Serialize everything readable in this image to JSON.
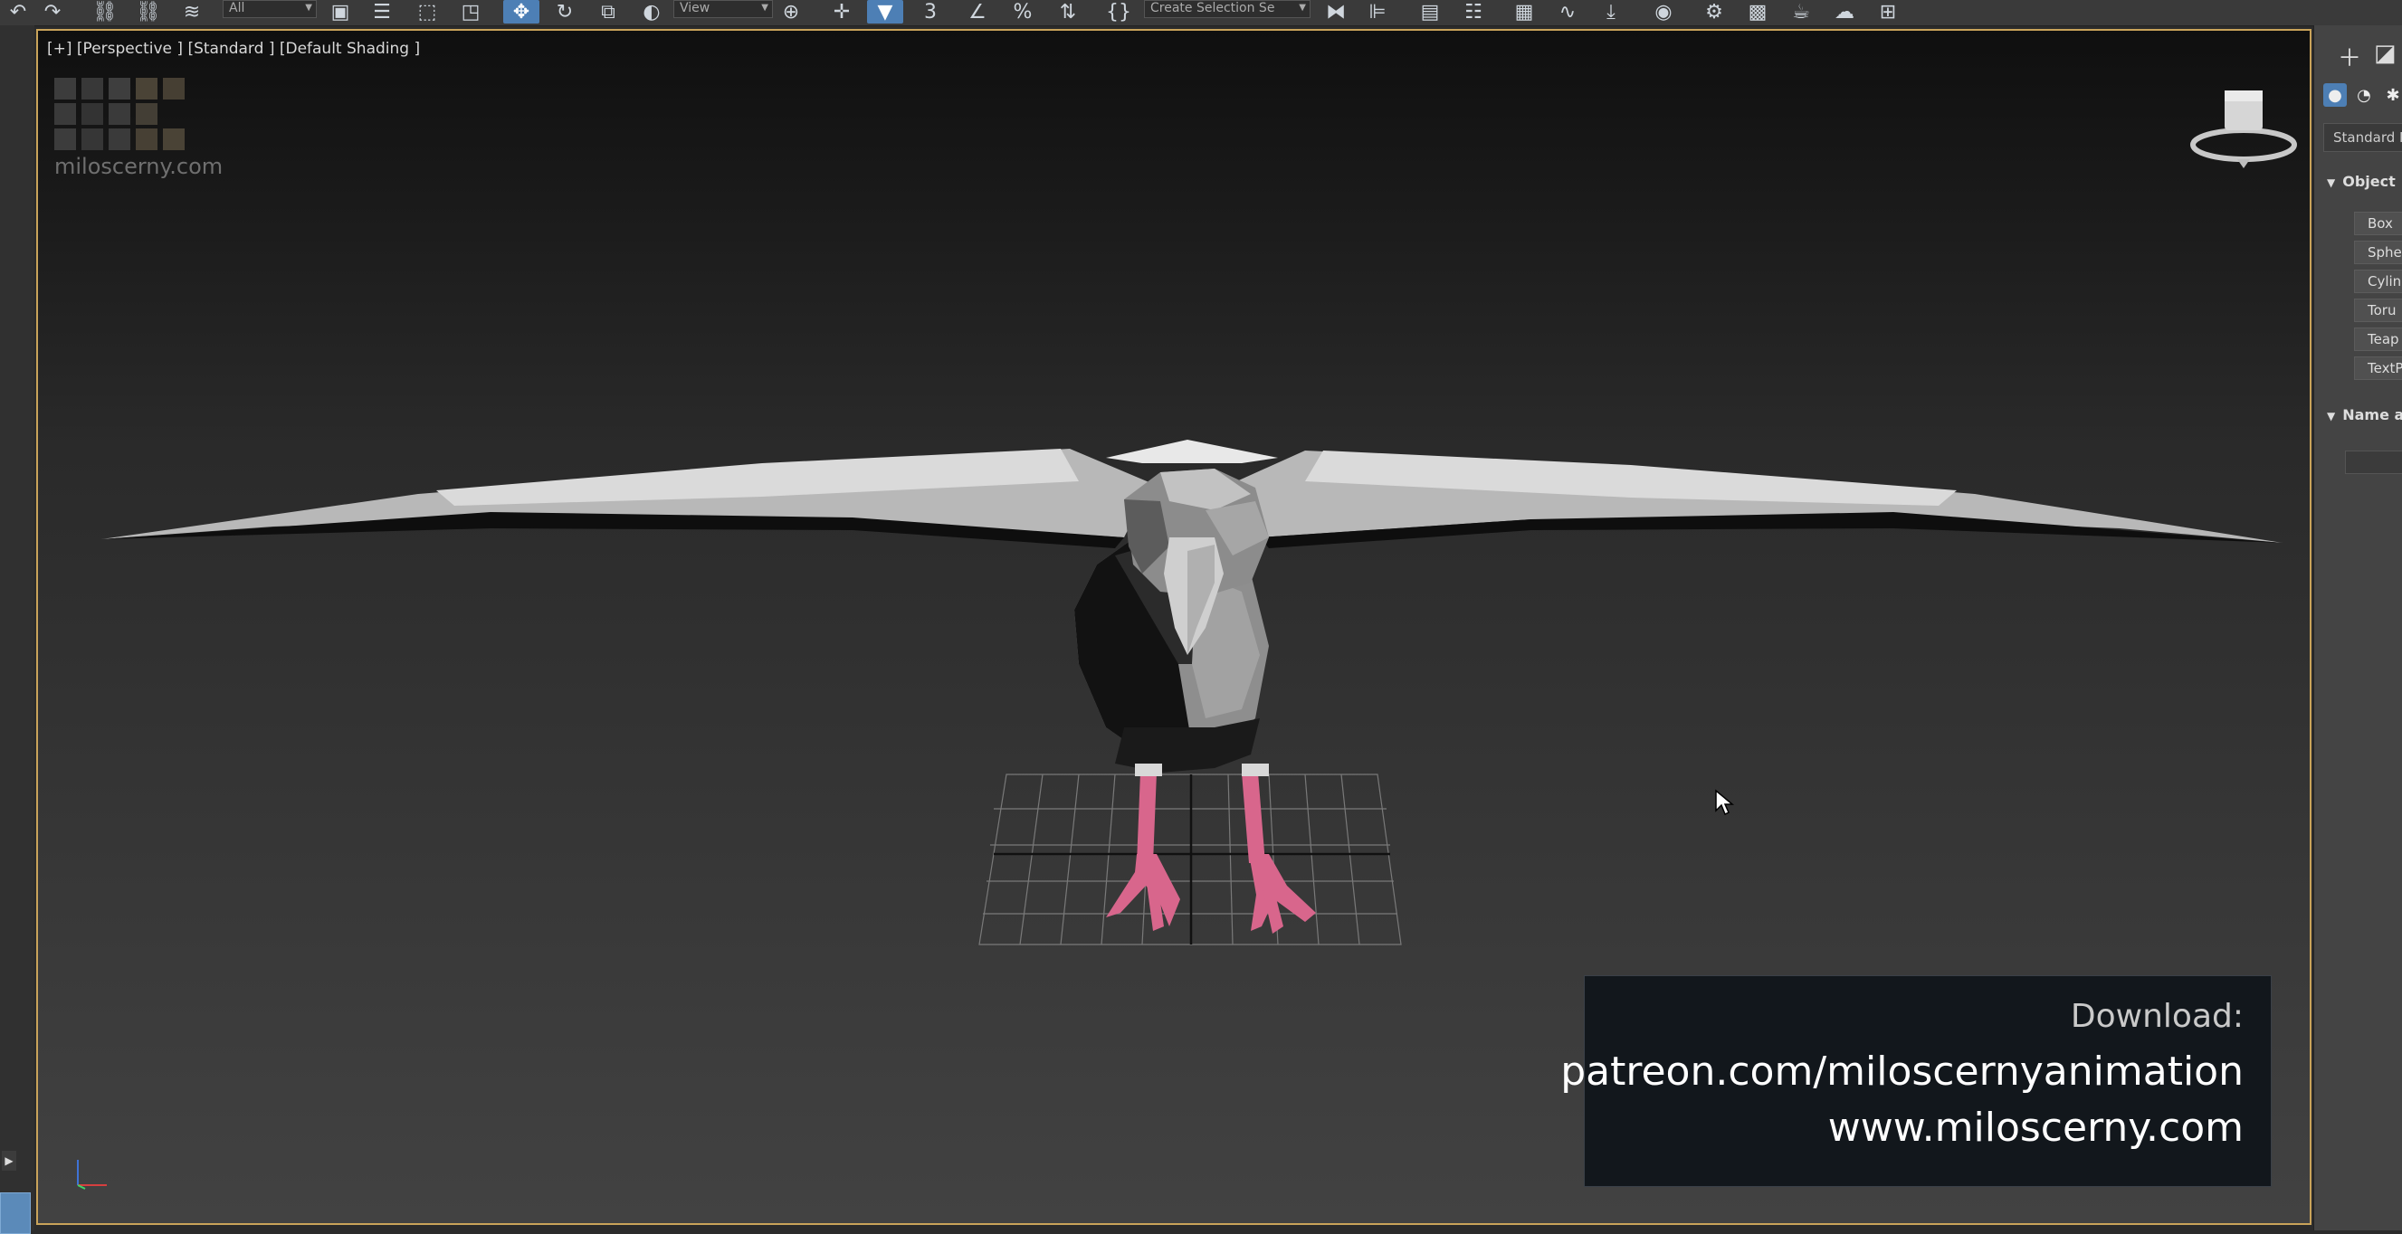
{
  "toolbar": {
    "selection_filter": "All",
    "ref_coord": "View",
    "named_selection": "Create Selection Se"
  },
  "viewport": {
    "label": "[+] [Perspective ] [Standard ] [Default Shading ]",
    "logo_text": "miloscerny.com"
  },
  "banner": {
    "line1": "Download:",
    "line2": "patreon.com/miloscernyanimation",
    "line3": "www.miloscerny.com"
  },
  "command_panel": {
    "category": "Standard P",
    "rollout_object": "Object",
    "object_buttons": [
      "Box",
      "Sphe",
      "Cylinc",
      "Toru",
      "Teap",
      "TextP"
    ],
    "rollout_name": "Name a"
  },
  "colors": {
    "viewport_border": "#c9a35a",
    "active_tool": "#4d7fb5",
    "bird_feet": "#d8668c"
  },
  "icons": [
    "undo-icon",
    "redo-icon",
    "link-icon",
    "unlink-icon",
    "bind-space-warp-icon",
    "select-object-icon",
    "select-by-name-icon",
    "rect-selection-icon",
    "window-crossing-icon",
    "move-icon",
    "rotate-icon",
    "scale-icon",
    "placement-icon",
    "snap-icon",
    "angle-snap-icon",
    "percent-snap-icon",
    "spinner-snap-icon",
    "edit-named-selection-icon",
    "mirror-icon",
    "align-icon",
    "scene-explorer-icon",
    "layer-explorer-icon",
    "ribbon-icon",
    "curve-editor-icon",
    "schematic-view-icon",
    "material-editor-icon",
    "render-setup-icon",
    "rendered-frame-icon",
    "render-icon",
    "render-cloud-icon"
  ]
}
